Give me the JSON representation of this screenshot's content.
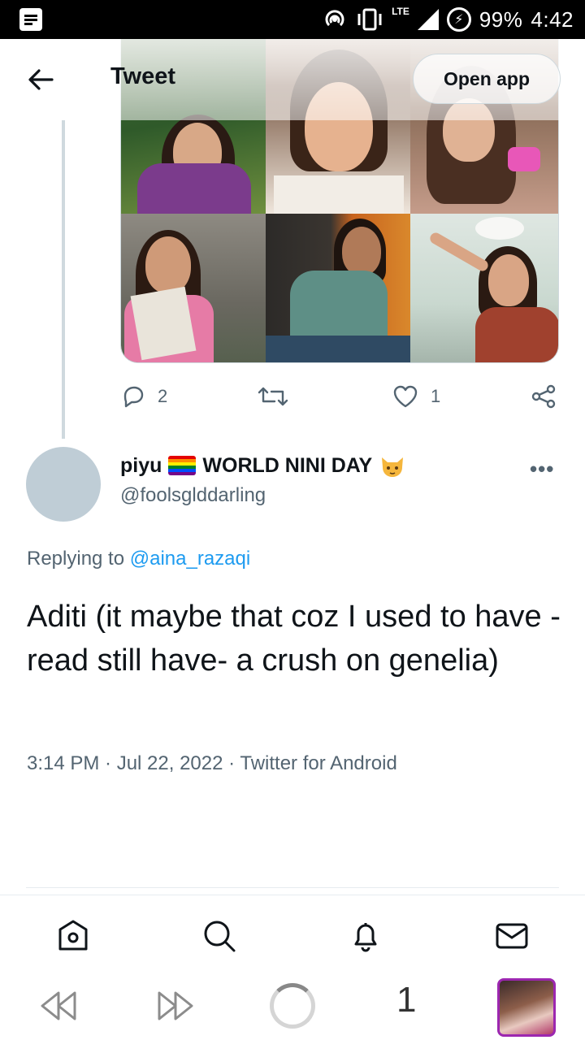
{
  "status_bar": {
    "battery": "99%",
    "time": "4:42",
    "network": "LTE"
  },
  "header": {
    "title": "Tweet",
    "open_app_label": "Open app"
  },
  "parent_tweet": {
    "reply_count": "2",
    "like_count": "1"
  },
  "reply": {
    "display_name_part1": "piyu",
    "display_name_part2": "WORLD NINI DAY",
    "handle": "@foolsglddarling",
    "replying_prefix": "Replying to",
    "replying_to": "@aina_razaqi",
    "text": "Aditi (it maybe that coz I used to have - read still have- a crush on genelia)",
    "timestamp": "3:14 PM · Jul 22, 2022 · Twitter for Android"
  },
  "browser": {
    "tab_count": "1"
  },
  "colors": {
    "accent": "#1d9bf0",
    "muted_text": "#536471",
    "avatar_placeholder": "#bfcdd6"
  },
  "icons": [
    "back-arrow-icon",
    "reply-icon",
    "retweet-icon",
    "like-icon",
    "share-icon",
    "more-icon",
    "home-icon",
    "search-icon",
    "notifications-icon",
    "messages-icon",
    "browser-back-icon",
    "browser-forward-icon"
  ]
}
